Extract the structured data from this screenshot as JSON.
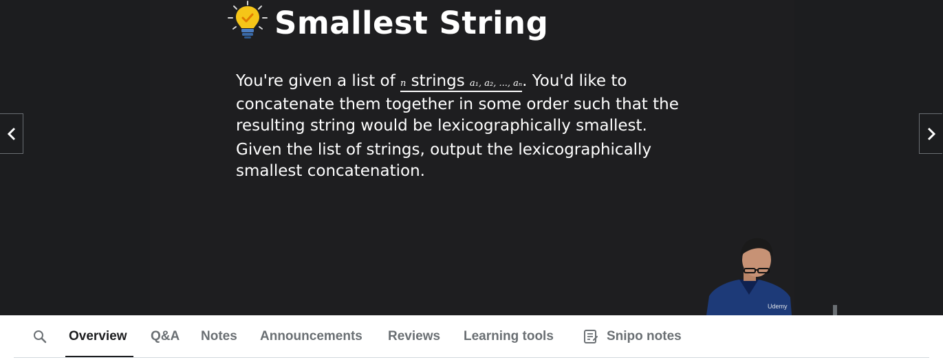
{
  "slide": {
    "title": "Smallest String",
    "p1": {
      "line1_a": "You're given a list of ",
      "line1_n": "n",
      "line1_strings": " strings ",
      "line1_seq": "a₁, a₂, ..., aₙ",
      "line1_b": ". You'd like to",
      "line2": "concatenate them together in some order such that the",
      "line3": "resulting string would be lexicographically smallest."
    },
    "p2": {
      "line1": "Given the list of strings, output the lexicographically",
      "line2": "smallest concatenation."
    },
    "watermark": "Udemy"
  },
  "tabs": [
    {
      "label": "Overview"
    },
    {
      "label": "Q&A"
    },
    {
      "label": "Notes"
    },
    {
      "label": "Announcements"
    },
    {
      "label": "Reviews"
    },
    {
      "label": "Learning tools"
    },
    {
      "label": "Snipo notes"
    }
  ],
  "icons": {
    "bulb": "lightbulb-icon",
    "prev": "chevron-left-icon",
    "next": "chevron-right-icon",
    "search": "search-icon",
    "snipo": "notes-icon"
  },
  "colors": {
    "player_bg": "#1c1d1f",
    "text": "#ffffff",
    "tab_active": "#1c1d1f",
    "tab_inactive": "#6a6f73",
    "bulb_yellow": "#f5c518"
  }
}
